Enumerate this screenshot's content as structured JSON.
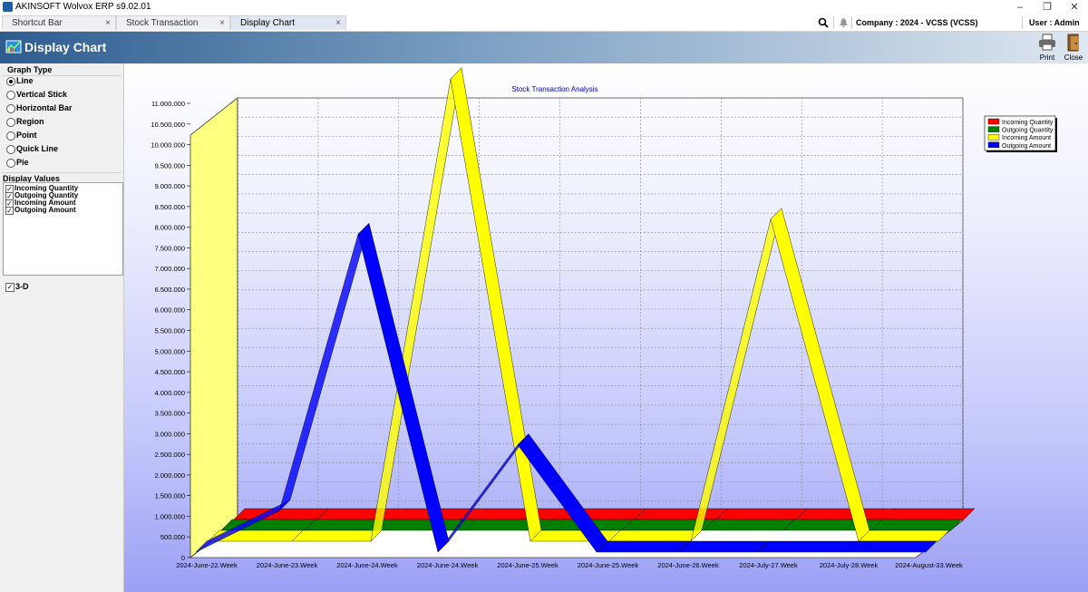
{
  "app": {
    "title": "AKINSOFT Wolvox ERP s9.02.01"
  },
  "window_controls": {
    "minimize": "–",
    "restore": "❐",
    "close": "✕"
  },
  "tabs": [
    {
      "label": "Shortcut Bar",
      "close": "×"
    },
    {
      "label": "Stock Transaction Analysis",
      "close": "×"
    },
    {
      "label": "Display Chart",
      "close": "×"
    }
  ],
  "topbar": {
    "company": "Company : 2024 - VCSS (VCSS)",
    "user": "User : Admin"
  },
  "header": {
    "title": "Display Chart",
    "print": "Print",
    "close": "Close"
  },
  "sidebar": {
    "graph_type_title": "Graph Type",
    "graph_types": [
      {
        "label": "Line",
        "checked": true
      },
      {
        "label": "Vertical Stick",
        "checked": false
      },
      {
        "label": "Horizontal Bar",
        "checked": false
      },
      {
        "label": "Region",
        "checked": false
      },
      {
        "label": "Point",
        "checked": false
      },
      {
        "label": "Quick Line",
        "checked": false
      },
      {
        "label": "Pie",
        "checked": false
      }
    ],
    "display_values_title": "Display Values",
    "display_values": [
      {
        "label": "Incoming Quantity",
        "checked": true
      },
      {
        "label": "Outgoing Quantity",
        "checked": true
      },
      {
        "label": "Incoming Amount",
        "checked": true
      },
      {
        "label": "Outgoing Amount",
        "checked": true
      }
    ],
    "three_d": {
      "label": "3-D",
      "checked": true
    }
  },
  "chart_data": {
    "type": "line",
    "title": "Stock Transaction Analysis",
    "three_d": true,
    "legend_position": "top-right",
    "categories": [
      "2024-June-22.Week",
      "2024-June-23.Week",
      "2024-June-24.Week",
      "2024-June-24.Week",
      "2024-June-25.Week",
      "2024-June-25.Week",
      "2024-June-26.Week",
      "2024-July-27.Week",
      "2024-July-28.Week",
      "2024-August-33.Week"
    ],
    "y_ticks": [
      "0",
      "500.000",
      "1.000.000",
      "1.500.000",
      "2.000.000",
      "2.500.000",
      "3.000.000",
      "3.500.000",
      "4.000.000",
      "4.500.000",
      "5.000.000",
      "5.500.000",
      "6.000.000",
      "6.500.000",
      "7.000.000",
      "7.500.000",
      "8.000.000",
      "8.500.000",
      "9.000.000",
      "9.500.000",
      "10.000.000",
      "10.500.000",
      "11.000.000"
    ],
    "ylim": [
      0,
      11000000
    ],
    "grid": true,
    "series": [
      {
        "name": "Incoming Quantity",
        "color": "#ff0000",
        "values": [
          0,
          0,
          0,
          0,
          0,
          0,
          0,
          0,
          0,
          0
        ]
      },
      {
        "name": "Outgoing Quantity",
        "color": "#008000",
        "values": [
          0,
          0,
          0,
          0,
          0,
          0,
          0,
          0,
          0,
          0
        ]
      },
      {
        "name": "Incoming Amount",
        "color": "#ffff00",
        "values": [
          0,
          0,
          0,
          11200000,
          0,
          0,
          0,
          7800000,
          0,
          0
        ]
      },
      {
        "name": "Outgoing Amount",
        "color": "#0000ff",
        "values": [
          0,
          1000000,
          7700000,
          0,
          2600000,
          0,
          0,
          0,
          0,
          0
        ]
      }
    ]
  }
}
